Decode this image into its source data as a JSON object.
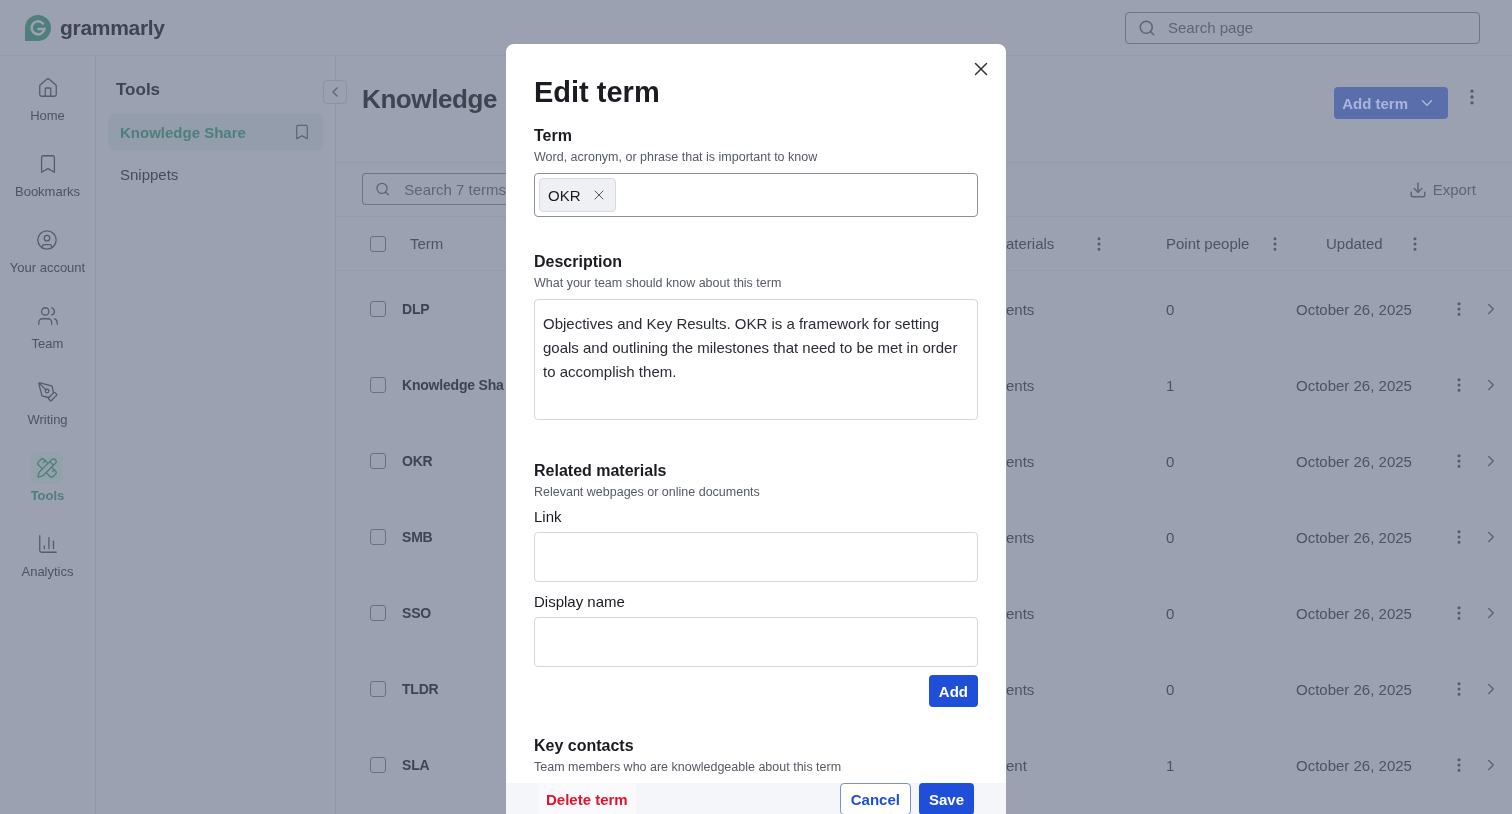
{
  "header": {
    "logo_text": "grammarly",
    "search": {
      "placeholder": "Search page"
    }
  },
  "rail": [
    {
      "label": "Home",
      "selected": false
    },
    {
      "label": "Bookmarks",
      "selected": false
    },
    {
      "label": "Your account",
      "selected": false
    },
    {
      "label": "Team",
      "selected": false
    },
    {
      "label": "Writing",
      "selected": false
    },
    {
      "label": "Tools",
      "selected": true
    },
    {
      "label": "Analytics",
      "selected": false
    }
  ],
  "tools_panel": {
    "title": "Tools",
    "items": [
      {
        "label": "Knowledge Share",
        "selected": true
      },
      {
        "label": "Snippets",
        "selected": false
      }
    ]
  },
  "main": {
    "heading": "Knowledge",
    "search": {
      "placeholder": "Search 7 terms"
    },
    "add_button": "Add term",
    "export_button": "Export",
    "select_all_checked": false,
    "columns_left": [
      "Term"
    ],
    "columns_right": [
      "aterials",
      "Point people",
      "Updated"
    ],
    "rows": [
      {
        "checked": false,
        "term": "DLP",
        "materials": "ents",
        "people": "0",
        "updated": "October 26, 2025"
      },
      {
        "checked": false,
        "term": "Knowledge Sha",
        "materials": "ents",
        "people": "1",
        "updated": "October 26, 2025"
      },
      {
        "checked": false,
        "term": "OKR",
        "materials": "ents",
        "people": "0",
        "updated": "October 26, 2025"
      },
      {
        "checked": false,
        "term": "SMB",
        "materials": "ents",
        "people": "0",
        "updated": "October 26, 2025"
      },
      {
        "checked": false,
        "term": "SSO",
        "materials": "ents",
        "people": "0",
        "updated": "October 26, 2025"
      },
      {
        "checked": false,
        "term": "TLDR",
        "materials": "ents",
        "people": "0",
        "updated": "October 26, 2025"
      },
      {
        "checked": false,
        "term": "SLA",
        "materials": "ent",
        "people": "1",
        "updated": "October 26, 2025"
      }
    ]
  },
  "modal": {
    "title": "Edit term",
    "term": {
      "label": "Term",
      "hint": "Word, acronym, or phrase that is important to know",
      "tags": [
        "OKR"
      ]
    },
    "description": {
      "label": "Description",
      "hint": "What your team should know about this term",
      "value": "Objectives and Key Results. OKR is a framework for setting goals and outlining the milestones that need to be met in order to accomplish them."
    },
    "related": {
      "label": "Related materials",
      "hint": "Relevant webpages or online documents",
      "link_label": "Link",
      "display_label": "Display name",
      "add_button": "Add"
    },
    "contacts": {
      "label": "Key contacts",
      "hint": "Team members who are knowledgeable about this term"
    },
    "footer": {
      "delete_button": "Delete term",
      "cancel_button": "Cancel",
      "save_button": "Save"
    }
  }
}
